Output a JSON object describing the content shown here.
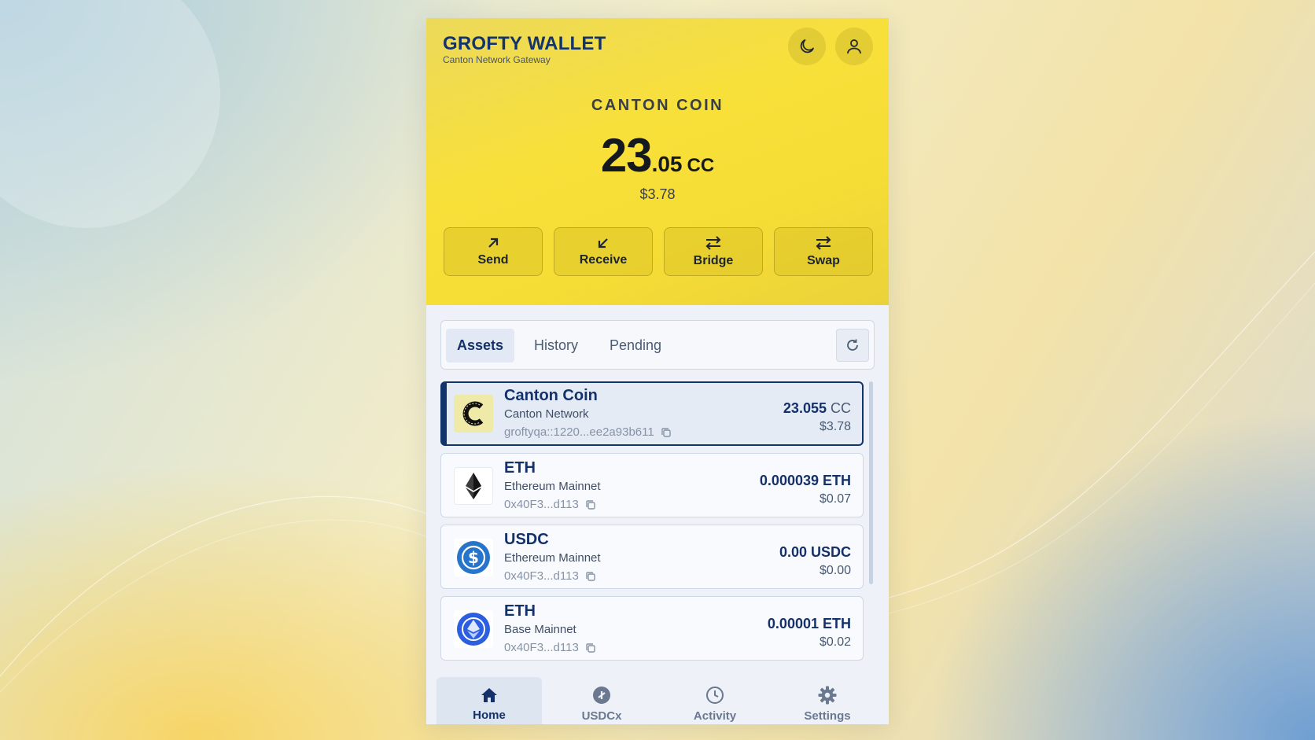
{
  "header": {
    "brand_title": "GROFTY WALLET",
    "brand_subtitle": "Canton Network Gateway",
    "theme_icon": "moon-icon",
    "profile_icon": "user-icon"
  },
  "balance": {
    "coin_name": "CANTON COIN",
    "integer": "23",
    "decimal": ".05",
    "unit": "CC",
    "usd": "$3.78"
  },
  "actions": [
    {
      "label": "Send",
      "icon": "arrow-up-right-icon"
    },
    {
      "label": "Receive",
      "icon": "arrow-down-left-icon"
    },
    {
      "label": "Bridge",
      "icon": "swap-arrows-icon"
    },
    {
      "label": "Swap",
      "icon": "swap-arrows-icon"
    }
  ],
  "tabs": [
    {
      "label": "Assets",
      "active": true
    },
    {
      "label": "History",
      "active": false
    },
    {
      "label": "Pending",
      "active": false
    }
  ],
  "refresh_icon": "refresh-icon",
  "assets": [
    {
      "name": "Canton Coin",
      "network": "Canton Network",
      "address": "groftyqa::1220...ee2a93b611",
      "amount": "23.055",
      "unit": "CC",
      "fiat": "$3.78",
      "logo": "canton-coin-logo",
      "selected": true
    },
    {
      "name": "ETH",
      "network": "Ethereum Mainnet",
      "address": "0x40F3...d113",
      "amount": "0.000039 ETH",
      "unit": "",
      "fiat": "$0.07",
      "logo": "ethereum-logo",
      "selected": false
    },
    {
      "name": "USDC",
      "network": "Ethereum Mainnet",
      "address": "0x40F3...d113",
      "amount": "0.00 USDC",
      "unit": "",
      "fiat": "$0.00",
      "logo": "usdc-logo",
      "selected": false
    },
    {
      "name": "ETH",
      "network": "Base Mainnet",
      "address": "0x40F3...d113",
      "amount": "0.00001 ETH",
      "unit": "",
      "fiat": "$0.02",
      "logo": "base-eth-logo",
      "selected": false
    }
  ],
  "nav": [
    {
      "label": "Home",
      "icon": "home-icon",
      "active": true
    },
    {
      "label": "USDCx",
      "icon": "usdcx-icon",
      "active": false
    },
    {
      "label": "Activity",
      "icon": "clock-icon",
      "active": false
    },
    {
      "label": "Settings",
      "icon": "gear-icon",
      "active": false
    }
  ],
  "colors": {
    "hero_yellow": "#f8e03a",
    "navy": "#13336b",
    "panel": "#eef2f8"
  }
}
